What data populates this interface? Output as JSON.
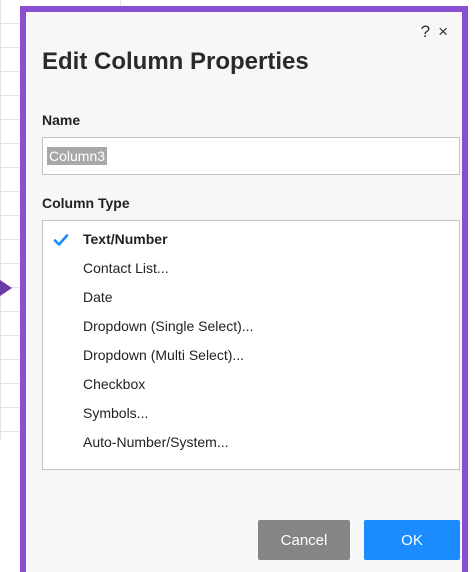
{
  "dialog": {
    "title": "Edit Column Properties",
    "help_label": "?",
    "close_label": "×",
    "name_label": "Name",
    "name_value": "Column3",
    "type_label": "Column Type",
    "types": [
      {
        "label": "Text/Number",
        "selected": true
      },
      {
        "label": "Contact List...",
        "selected": false
      },
      {
        "label": "Date",
        "selected": false
      },
      {
        "label": "Dropdown (Single Select)...",
        "selected": false
      },
      {
        "label": "Dropdown (Multi Select)...",
        "selected": false
      },
      {
        "label": "Checkbox",
        "selected": false
      },
      {
        "label": "Symbols...",
        "selected": false
      },
      {
        "label": "Auto-Number/System...",
        "selected": false
      }
    ],
    "cancel_label": "Cancel",
    "ok_label": "OK"
  },
  "colors": {
    "border": "#8a4fd0",
    "accent": "#1a8cff",
    "cancel": "#858585"
  }
}
